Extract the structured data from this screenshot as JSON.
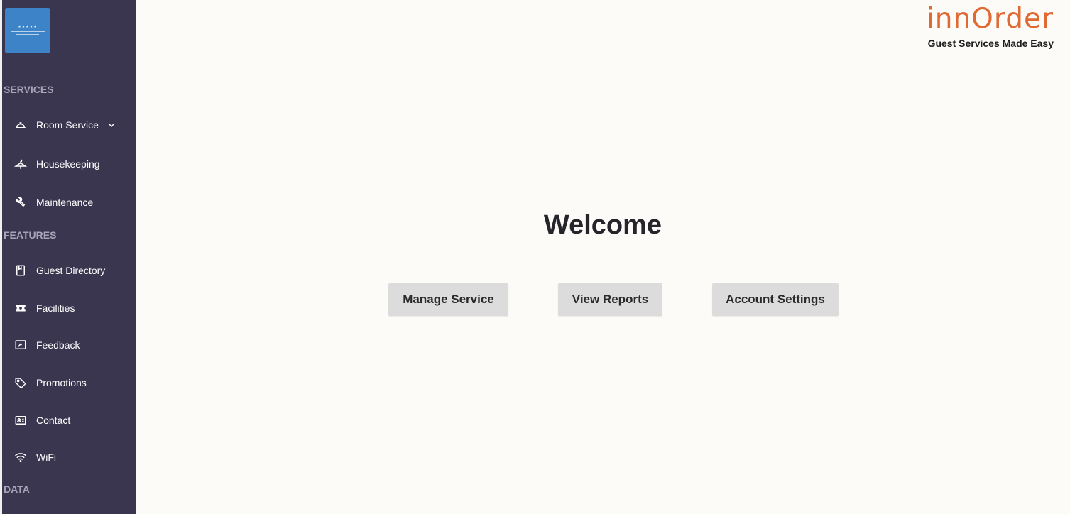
{
  "brand": {
    "name": "innOrder",
    "tagline": "Guest Services Made Easy",
    "color": "#e06a34"
  },
  "sidebar": {
    "background": "#3a364f",
    "hotel_logo_stars": "★★★★★",
    "sections": {
      "services": "SERVICES",
      "features": "FEATURES",
      "data": "DATA"
    },
    "items": [
      {
        "label": "Room Service",
        "icon": "service-bell-icon"
      },
      {
        "label": "Housekeeping",
        "icon": "hanger-icon"
      },
      {
        "label": "Maintenance",
        "icon": "wrench-icon"
      },
      {
        "label": "Guest Directory",
        "icon": "book-icon"
      },
      {
        "label": "Facilities",
        "icon": "ticket-icon"
      },
      {
        "label": "Feedback",
        "icon": "feedback-icon"
      },
      {
        "label": "Promotions",
        "icon": "tag-icon"
      },
      {
        "label": "Contact",
        "icon": "contact-card-icon"
      },
      {
        "label": "WiFi",
        "icon": "wifi-icon"
      }
    ]
  },
  "main": {
    "title": "Welcome",
    "buttons": {
      "manage": "Manage Service",
      "reports": "View Reports",
      "settings": "Account Settings"
    }
  }
}
